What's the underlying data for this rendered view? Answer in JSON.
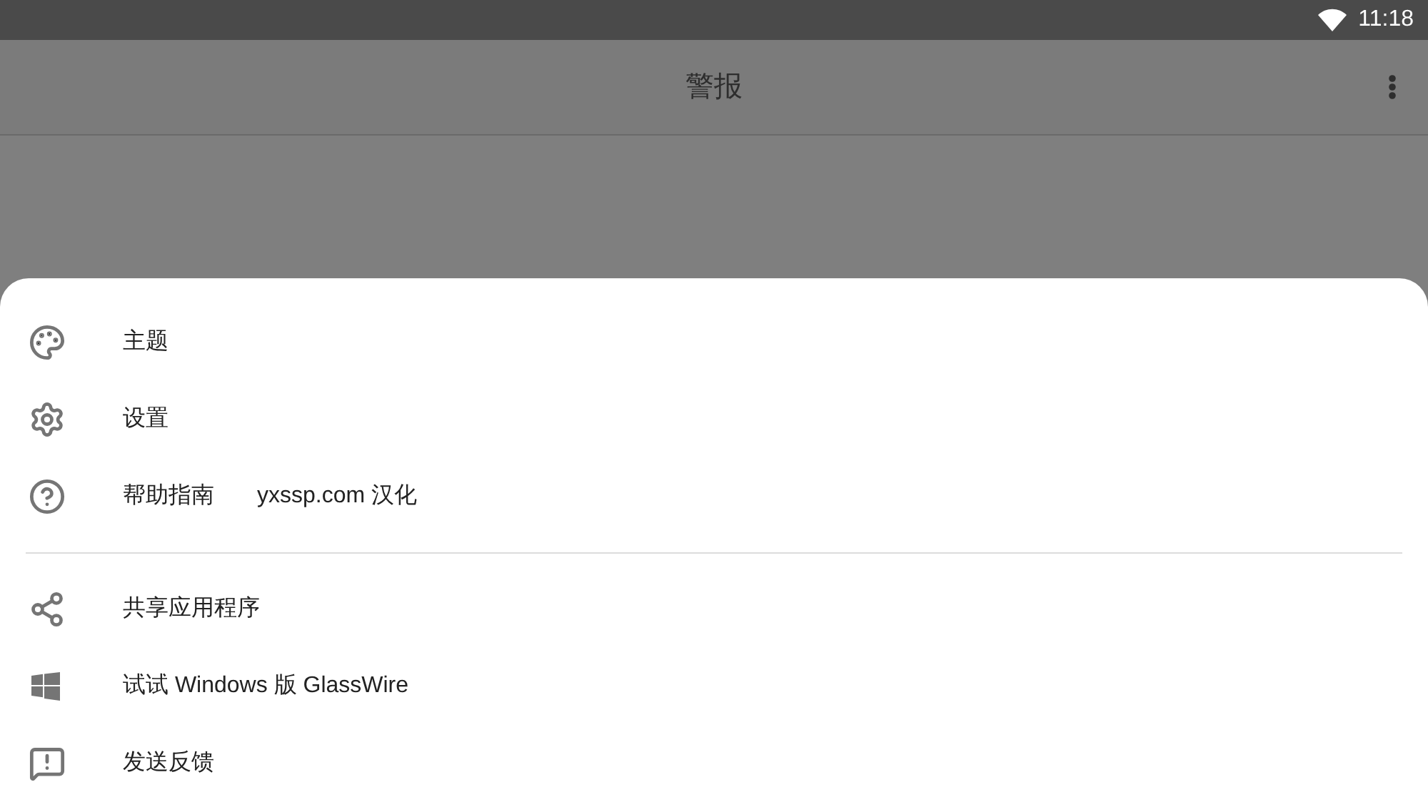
{
  "status_bar": {
    "time": "11:18"
  },
  "app_bar": {
    "title": "警报"
  },
  "menu": {
    "groups": [
      {
        "items": [
          {
            "label": "主题"
          },
          {
            "label": "设置"
          },
          {
            "label": "帮助指南",
            "note": "yxssp.com 汉化"
          }
        ]
      },
      {
        "items": [
          {
            "label": "共享应用程序"
          },
          {
            "label": "试试 Windows 版 GlassWire"
          },
          {
            "label": "发送反馈"
          }
        ]
      }
    ]
  }
}
